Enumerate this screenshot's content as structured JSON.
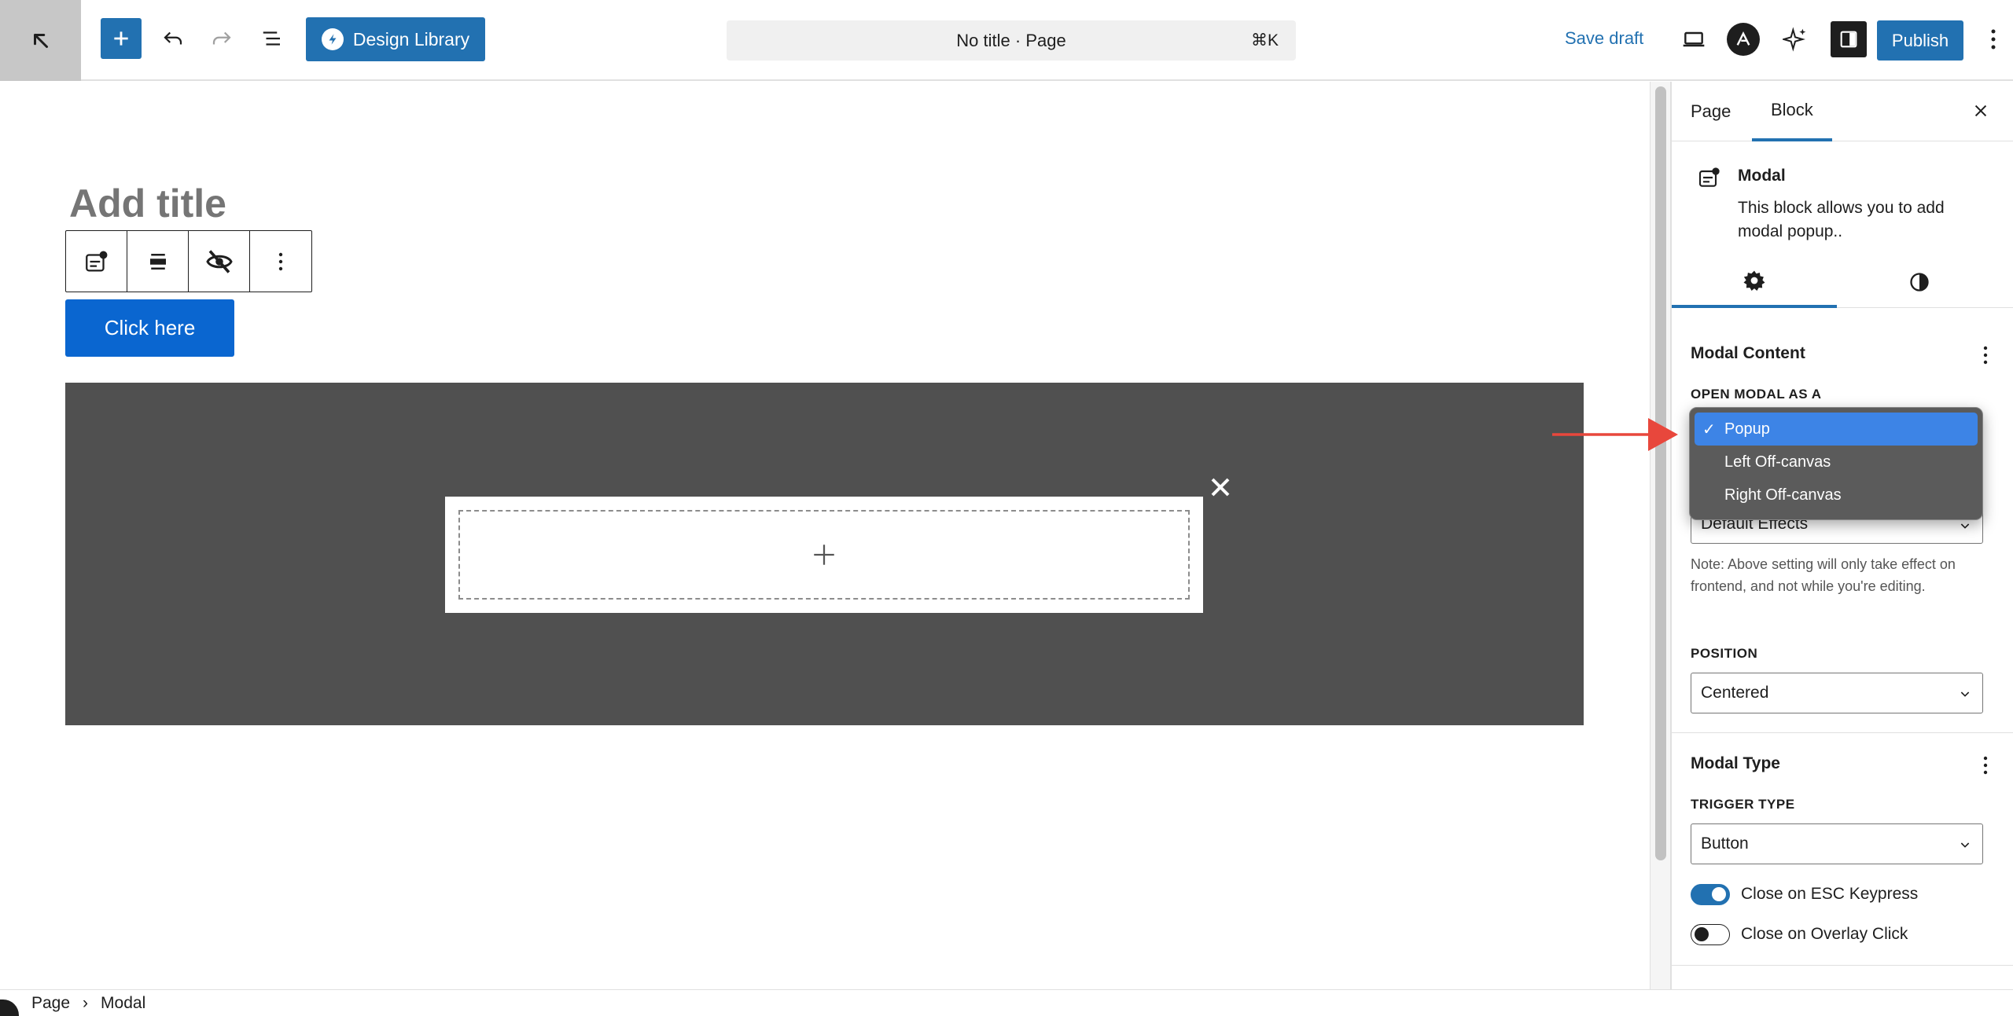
{
  "topbar": {
    "design_library_label": "Design Library",
    "document_title": "No title · Page",
    "shortcut": "⌘K",
    "save_draft_label": "Save draft",
    "publish_label": "Publish"
  },
  "editor": {
    "title_placeholder": "Add title",
    "button_text": "Click here"
  },
  "sidebar": {
    "tabs": [
      {
        "label": "Page"
      },
      {
        "label": "Block"
      }
    ],
    "active_tab": "Block",
    "block": {
      "name": "Modal",
      "description": "This block allows you to add modal popup.."
    },
    "panels": {
      "modal_content": {
        "title": "Modal Content",
        "open_modal_label": "OPEN MODAL AS A",
        "effect_value": "Default Effects",
        "note": "Note: Above setting will only take effect on frontend, and not while you're editing.",
        "position_label": "POSITION",
        "position_value": "Centered"
      },
      "modal_type": {
        "title": "Modal Type",
        "trigger_label": "TRIGGER TYPE",
        "trigger_value": "Button",
        "toggles": [
          {
            "label": "Close on ESC Keypress",
            "on": true
          },
          {
            "label": "Close on Overlay Click",
            "on": false
          }
        ]
      }
    }
  },
  "dropdown": {
    "options": [
      {
        "label": "Popup",
        "selected": true
      },
      {
        "label": "Left Off-canvas",
        "selected": false
      },
      {
        "label": "Right Off-canvas",
        "selected": false
      }
    ],
    "check_mark": "✓"
  },
  "breadcrumb": {
    "items": [
      "Page",
      "Modal"
    ],
    "separator": "›"
  },
  "colors": {
    "accent": "#2271b1",
    "button_blue": "#0a66d0",
    "overlay": "#505050",
    "annotation_arrow": "#e8473c",
    "dropdown_selected": "#3d84e6"
  }
}
